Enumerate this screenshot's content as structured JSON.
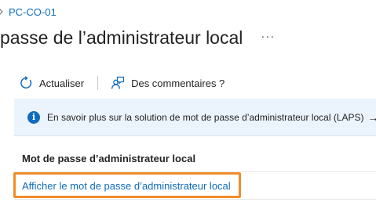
{
  "breadcrumb": {
    "items": [
      "PC-CO-01"
    ]
  },
  "header": {
    "title": "passe de l’administrateur local",
    "more_label": "···"
  },
  "toolbar": {
    "refresh_label": "Actualiser",
    "feedback_label": "Des commentaires ?"
  },
  "info_banner": {
    "text": "En savoir plus sur la solution de mot de passe d’administrateur local (LAPS)",
    "arrow": "→"
  },
  "section": {
    "header": "Mot de passe d’administrateur local",
    "link_label": "Afficher le mot de passe d’administrateur local"
  },
  "colors": {
    "accent": "#0f6cbd",
    "banner_bg": "#ebf3fc",
    "highlight": "#f28c28"
  },
  "icons": {
    "breadcrumb_separator": "chevron-right-icon",
    "refresh": "refresh-icon",
    "feedback": "feedback-person-icon",
    "info": "info-icon",
    "more": "more-icon"
  }
}
